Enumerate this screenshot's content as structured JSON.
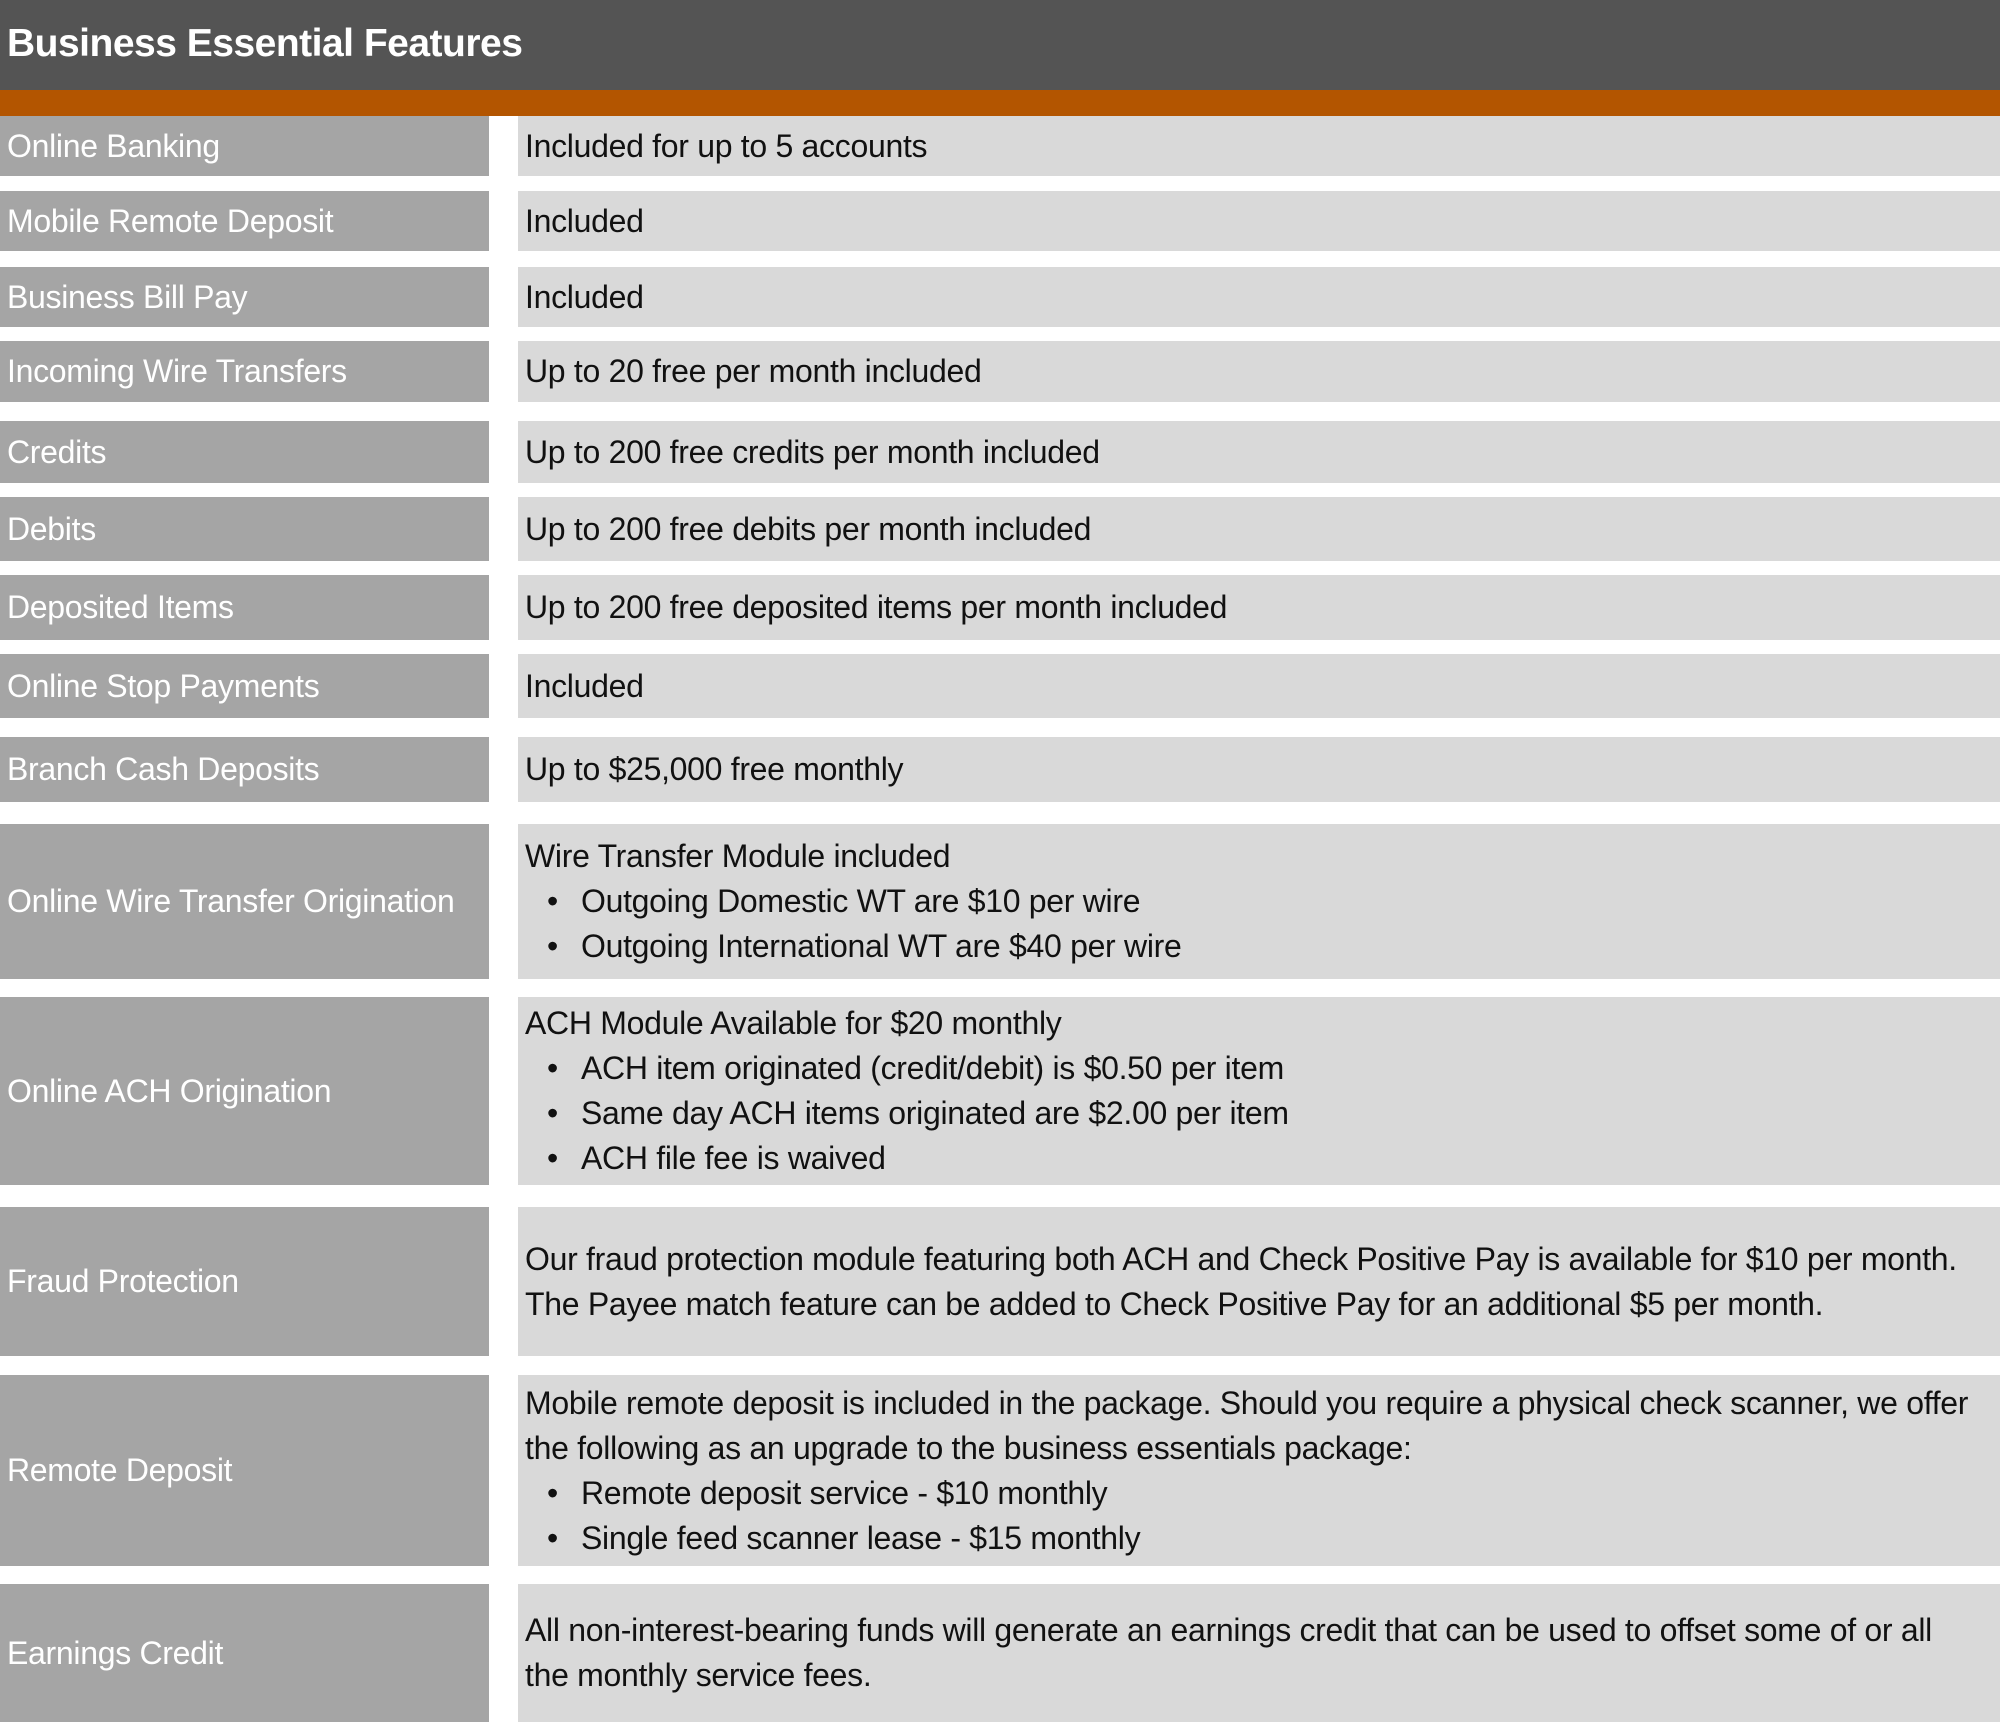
{
  "header": {
    "title": "Business Essential Features"
  },
  "colors": {
    "header_bg": "#545454",
    "accent": "#b35500",
    "label_bg": "#a5a5a5",
    "value_bg": "#d9d9d9"
  },
  "rows": [
    {
      "label": "Online Banking",
      "value": "Included for up to 5 accounts"
    },
    {
      "label": "Mobile Remote Deposit",
      "value": "Included"
    },
    {
      "label": "Business Bill Pay",
      "value": "Included"
    },
    {
      "label": "Incoming Wire Transfers",
      "value": "Up to 20 free per month included"
    },
    {
      "label": "Credits",
      "value": "Up to 200 free credits per month included"
    },
    {
      "label": "Debits",
      "value": "Up to 200 free debits per month included"
    },
    {
      "label": "Deposited Items",
      "value": "Up to 200 free deposited items per month included"
    },
    {
      "label": "Online Stop Payments",
      "value": "Included"
    },
    {
      "label": "Branch Cash Deposits",
      "value": "Up to $25,000 free monthly"
    },
    {
      "label": "Online Wire Transfer Origination",
      "value": "Wire Transfer Module included",
      "bullets": [
        "Outgoing Domestic WT are $10 per wire",
        "Outgoing International WT are $40 per wire"
      ]
    },
    {
      "label": "Online ACH Origination",
      "value": "ACH Module Available for $20 monthly",
      "bullets": [
        "ACH item originated (credit/debit) is $0.50 per item",
        "Same day ACH items originated are $2.00 per item",
        "ACH file fee is waived"
      ]
    },
    {
      "label": "Fraud Protection",
      "value": "Our fraud protection module featuring both ACH and Check Positive Pay is available for $10 per month. The Payee match feature can be added to Check Positive Pay for an additional $5 per month."
    },
    {
      "label": "Remote Deposit",
      "value": "Mobile remote deposit is included in the package. Should you require a physical check scanner, we offer the following as an upgrade to the business essentials package:",
      "bullets": [
        "Remote deposit service - $10 monthly",
        "Single feed scanner lease - $15 monthly"
      ]
    },
    {
      "label": "Earnings Credit",
      "value": "All non-interest-bearing funds will generate an earnings credit that can be used to offset some of or all the monthly service fees."
    }
  ],
  "bullet_glyph": "•"
}
